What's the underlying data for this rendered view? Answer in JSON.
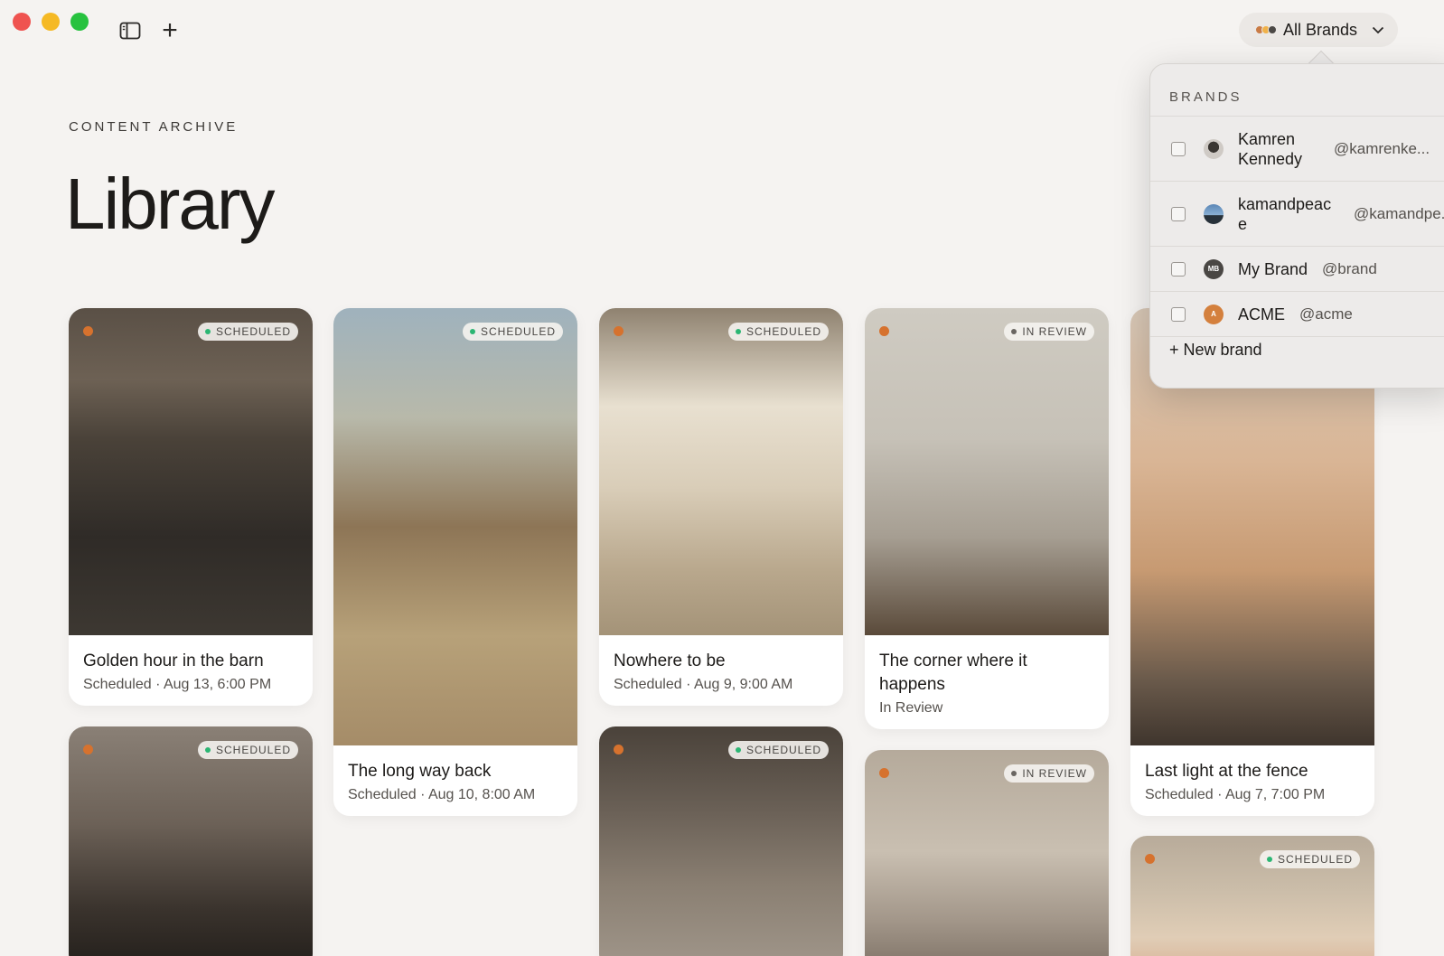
{
  "window": {
    "controls": [
      "close",
      "minimize",
      "zoom"
    ]
  },
  "toolbar": {
    "sidebar_icon": "sidebar-toggle-icon",
    "new_label": "+",
    "brand_switch_label": "All Brands",
    "brand_dot_colors": [
      "#c97b45",
      "#f0b24a",
      "#4b4845"
    ]
  },
  "header": {
    "eyebrow": "CONTENT ARCHIVE",
    "title": "Library"
  },
  "cards": [
    {
      "title": "Golden hour in the barn",
      "meta": "Scheduled · Aug 13, 6:00 PM",
      "badge": "SCHEDULED"
    },
    {
      "title": "The long way back",
      "meta": "Scheduled · Aug 10, 8:00 AM",
      "badge": "SCHEDULED"
    },
    {
      "title": "Nowhere to be",
      "meta": "Scheduled · Aug 9, 9:00 AM",
      "badge": "SCHEDULED"
    },
    {
      "title": "The corner where it happens",
      "meta": "In Review",
      "badge": "IN REVIEW"
    },
    {
      "title": "Last light at the fence",
      "meta": "Scheduled · Aug 7, 7:00 PM",
      "badge": ""
    },
    {
      "title": "",
      "meta": "",
      "badge": "SCHEDULED"
    },
    {
      "title": "",
      "meta": "",
      "badge": "SCHEDULED"
    },
    {
      "title": "",
      "meta": "",
      "badge": "IN REVIEW"
    },
    {
      "title": "",
      "meta": "",
      "badge": "SCHEDULED"
    }
  ],
  "brands_menu": {
    "heading": "BRANDS",
    "items": [
      {
        "name": "Kamren Kennedy",
        "handle": "@kamrenke...",
        "checked": false
      },
      {
        "name": "kamandpeace",
        "handle": "@kamandpe...",
        "checked": false
      },
      {
        "name": "My Brand",
        "handle": "@brand",
        "avatar_text": "MB",
        "checked": false
      },
      {
        "name": "ACME",
        "handle": "@acme",
        "avatar_text": "A",
        "checked": false
      }
    ],
    "new_brand_label": "+ New brand"
  }
}
